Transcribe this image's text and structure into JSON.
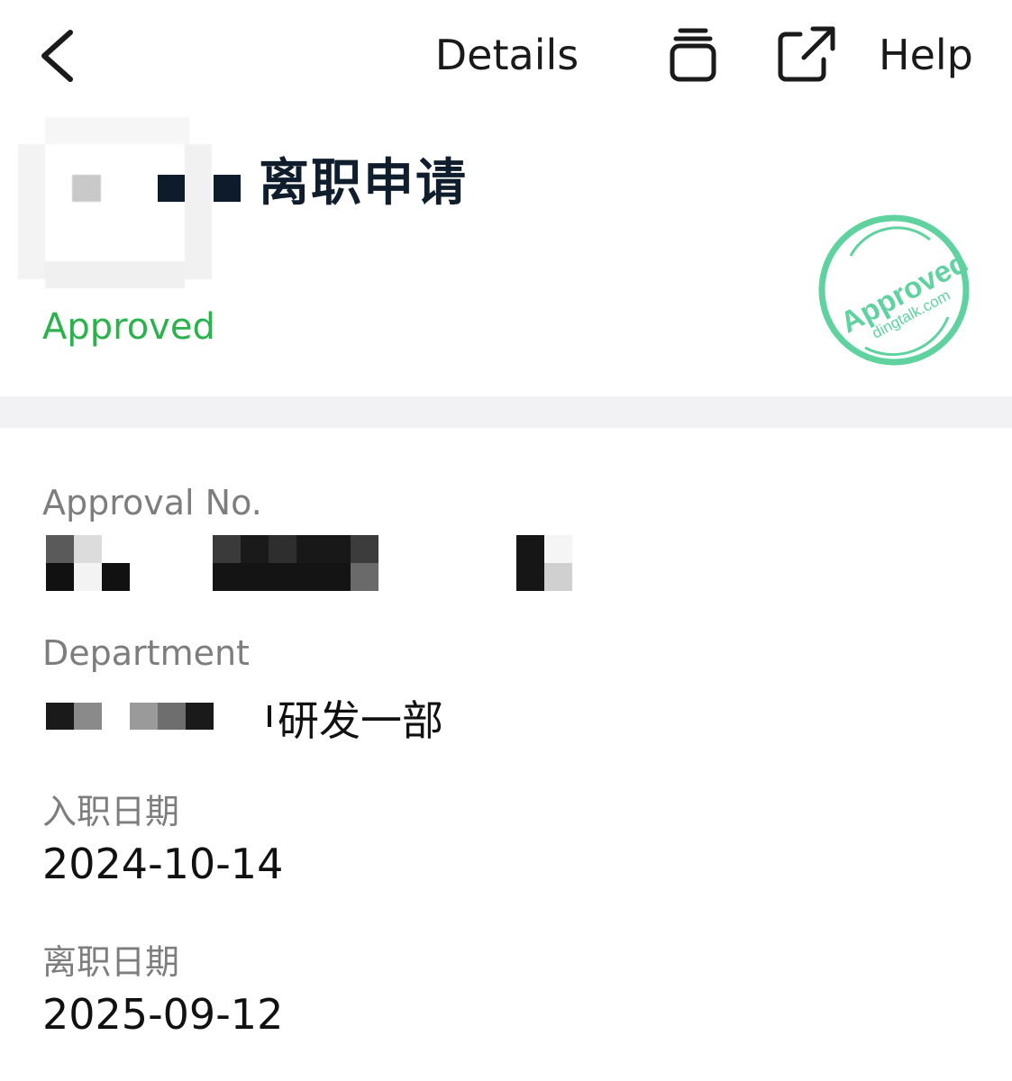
{
  "header": {
    "title": "Details",
    "help_label": "Help",
    "icons": {
      "back": "chevron-left-icon",
      "stack": "stack-icon",
      "share": "external-link-icon"
    }
  },
  "form": {
    "title": "离职申请",
    "status": "Approved",
    "status_color": "#2bb24c",
    "stamp": {
      "text": "Approved",
      "subtext": "dingtalk.com",
      "color": "#5fd2a0"
    }
  },
  "fields": {
    "approval_no": {
      "label": "Approval No."
    },
    "department": {
      "label": "Department",
      "visible_suffix": "研发一部"
    },
    "hire_date": {
      "label": "入职日期",
      "value": "2024-10-14"
    },
    "leave_date": {
      "label": "离职日期",
      "value": "2025-09-12"
    }
  }
}
